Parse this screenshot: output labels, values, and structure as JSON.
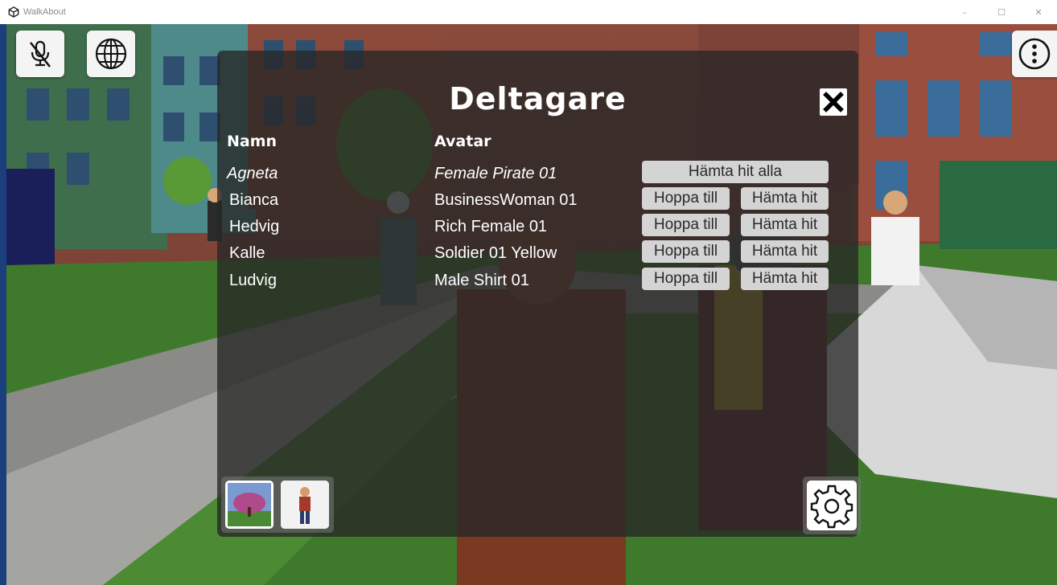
{
  "window": {
    "title": "WalkAbout",
    "controls": [
      "–",
      "☐",
      "✕"
    ]
  },
  "hud": {
    "mic_icon": "mic-muted-icon",
    "language_icon": "globe-icon",
    "menu_icon": "more-vertical-icon"
  },
  "panel": {
    "title": "Deltagare",
    "close_icon": "close-x-icon",
    "headers": {
      "name": "Namn",
      "avatar": "Avatar"
    },
    "fetch_all_label": "Hämta hit alla",
    "participants": [
      {
        "name": "Agneta",
        "avatar": "Female Pirate 01",
        "self": true
      },
      {
        "name": "Bianca",
        "avatar": "BusinessWoman 01",
        "jump": "Hoppa till",
        "fetch": "Hämta hit"
      },
      {
        "name": "Hedvig",
        "avatar": "Rich Female 01",
        "jump": "Hoppa till",
        "fetch": "Hämta hit"
      },
      {
        "name": "Kalle",
        "avatar": "Soldier 01 Yellow",
        "jump": "Hoppa till",
        "fetch": "Hämta hit"
      },
      {
        "name": "Ludvig",
        "avatar": "Male Shirt 01",
        "jump": "Hoppa till",
        "fetch": "Hämta hit"
      }
    ],
    "scene_thumb_icon": "scene-thumbnail-icon",
    "avatar_thumb_icon": "avatar-thumbnail-icon",
    "settings_icon": "gear-icon"
  }
}
